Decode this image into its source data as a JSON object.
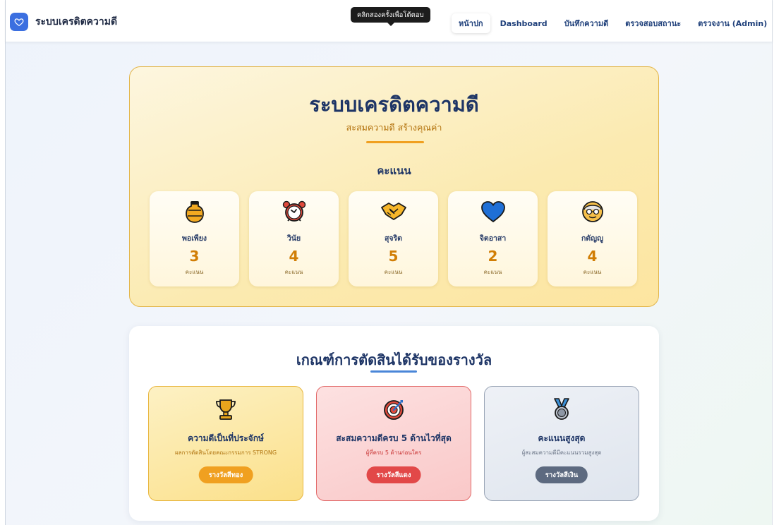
{
  "navbar": {
    "brand": "ระบบเครดิตความดี",
    "tooltip": "คลิกสองครั้งเพื่อโต้ตอบ",
    "links": [
      "หน้าปก",
      "Dashboard",
      "บันทึกความดี",
      "ตรวจสอบสถานะ",
      "ตรวจงาน (Admin)"
    ],
    "active_link": "หน้าปก"
  },
  "hero": {
    "title": "ระบบเครดิตความดี",
    "subtitle": "สะสมความดี สร้างคุณค่า",
    "section_title": "คะแนน",
    "scores": [
      {
        "name": "พอเพียง",
        "value": "3",
        "unit": "คะแนน",
        "icon": "amphora-icon"
      },
      {
        "name": "วินัย",
        "value": "4",
        "unit": "คะแนน",
        "icon": "alarm-clock-icon"
      },
      {
        "name": "สุจริต",
        "value": "5",
        "unit": "คะแนน",
        "icon": "handshake-icon"
      },
      {
        "name": "จิตอาสา",
        "value": "2",
        "unit": "คะแนน",
        "icon": "blue-heart-icon"
      },
      {
        "name": "กตัญญู",
        "value": "4",
        "unit": "คะแนน",
        "icon": "elder-face-icon"
      }
    ]
  },
  "criteria": {
    "title": "เกณฑ์การตัดสินได้รับของรางวัล",
    "awards": [
      {
        "title": "ความดีเป็นที่ประจักษ์",
        "desc": "ผลการตัดสินโดยคณะกรรมการ STRONG",
        "badge": "รางวัลสีทอง",
        "icon": "trophy-icon"
      },
      {
        "title": "สะสมความดีครบ 5 ด้านไวที่สุด",
        "desc": "ผู้ที่ครบ 5 ด้านก่อนใคร",
        "badge": "รางวัลสีแดง",
        "icon": "target-icon"
      },
      {
        "title": "คะแนนสูงสุด",
        "desc": "ผู้สะสมความดีมีคะแนนรวมสูงสุด",
        "badge": "รางวัลสีเงิน",
        "icon": "silver-medal-icon"
      }
    ]
  },
  "colors": {
    "accent_blue": "#3b6fe0",
    "hero_border": "#e3b64b",
    "score_value": "#d17e06",
    "gold_badge": "#f0a020",
    "red_badge": "#e24848",
    "silver_badge": "#5d6a80"
  }
}
